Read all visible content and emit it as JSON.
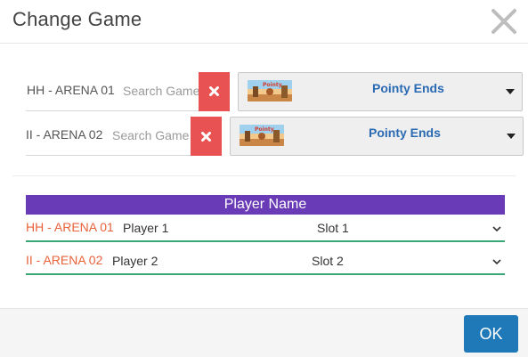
{
  "dialog": {
    "title": "Change Game"
  },
  "arenas": [
    {
      "name": "HH - ARENA 01",
      "search_placeholder": "Search Game",
      "game": "Pointy Ends",
      "thumb_text": "Pointy"
    },
    {
      "name": "II - ARENA 02",
      "search_placeholder": "Search Game",
      "game": "Pointy Ends",
      "thumb_text": "Pointy"
    }
  ],
  "player_table": {
    "header": "Player Name",
    "rows": [
      {
        "arena": "HH - ARENA 01",
        "player": "Player 1",
        "slot": "Slot 1"
      },
      {
        "arena": "II - ARENA 02",
        "player": "Player 2",
        "slot": "Slot 2"
      }
    ]
  },
  "footer": {
    "ok_label": "OK"
  },
  "colors": {
    "clear_button": "#e85252",
    "game_name": "#2a6ab3",
    "table_header": "#6a3bb6",
    "arena_accent": "#e8623a",
    "row_underline": "#3aa876",
    "ok_button": "#1f79b8"
  },
  "icons": {
    "close": "close-icon",
    "clear": "clear-x-icon",
    "dropdown": "caret-down-icon",
    "select": "chevron-down-icon"
  }
}
